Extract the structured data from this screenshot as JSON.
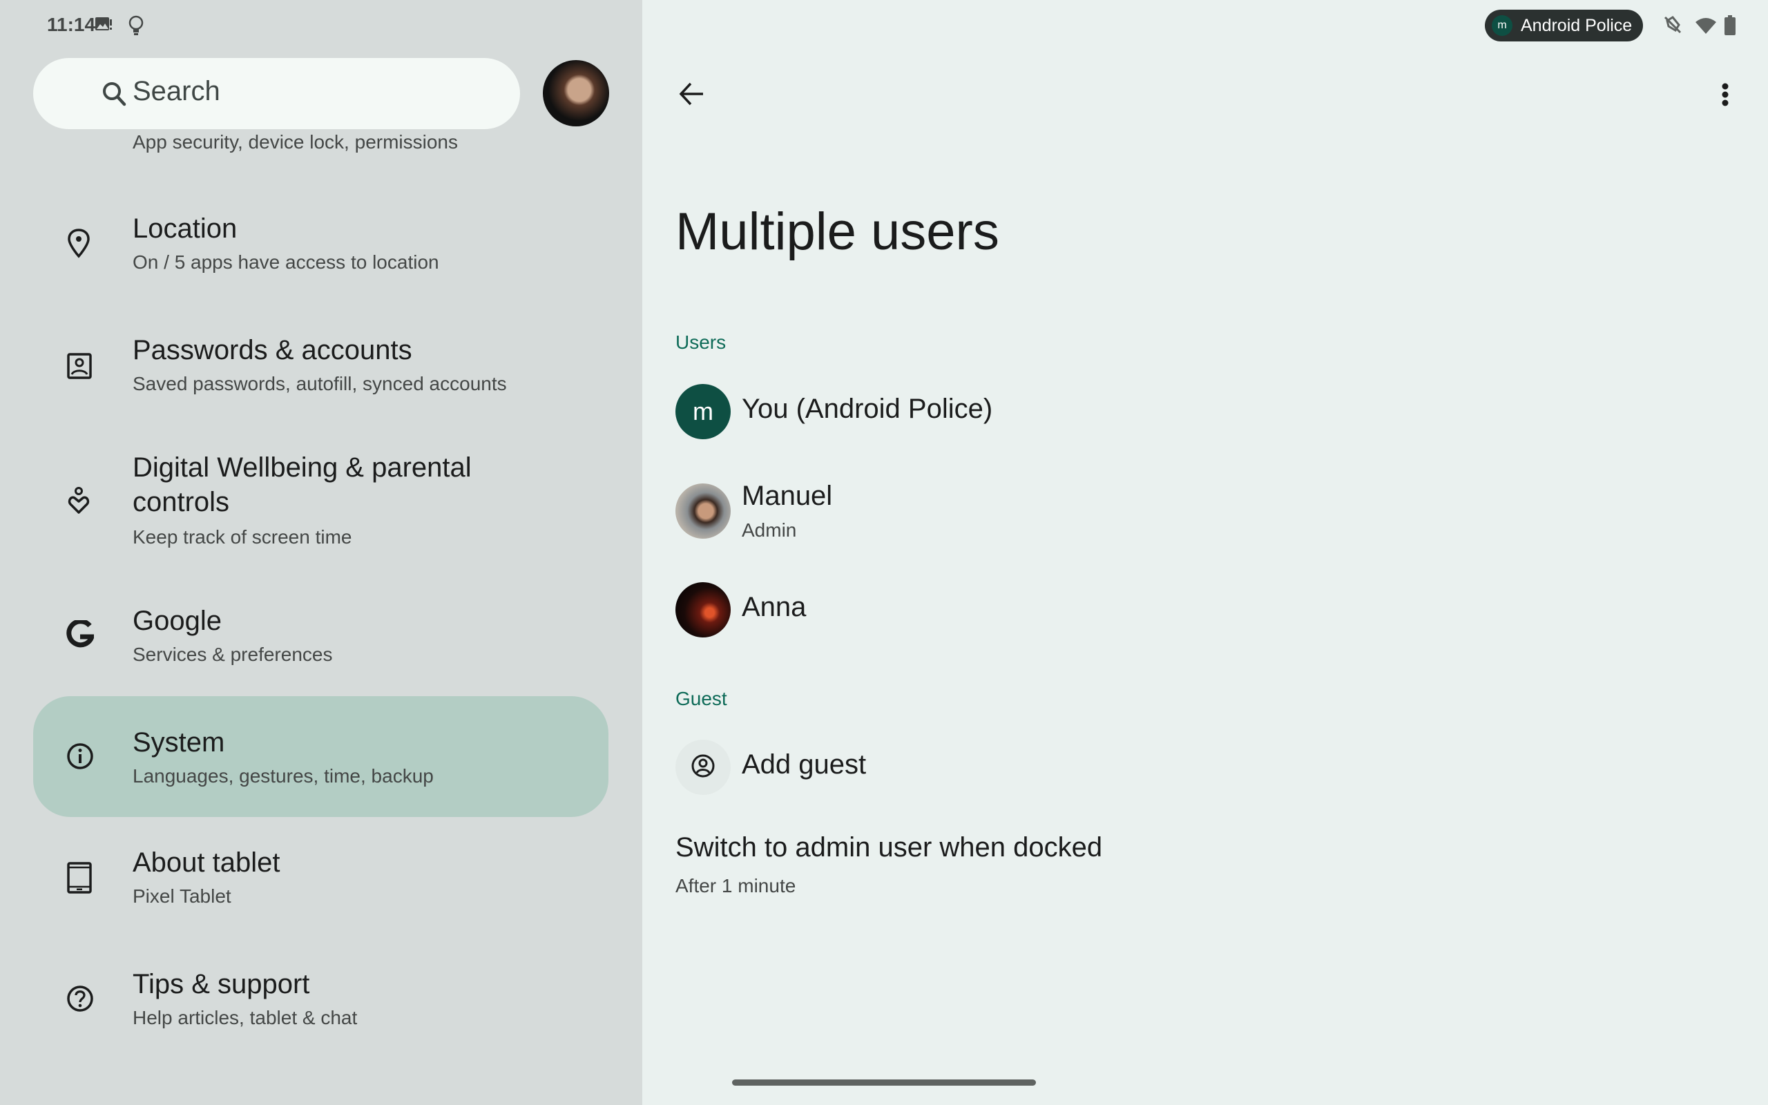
{
  "status_bar": {
    "time": "11:14",
    "left_icons": [
      "image-alert-icon",
      "lightbulb-icon"
    ],
    "user_chip": {
      "initial": "m",
      "name": "Android Police"
    },
    "right_icons": [
      "vibrate-off-icon",
      "wifi-icon",
      "battery-icon"
    ]
  },
  "colors": {
    "left_pane_bg": "#d6dbda",
    "right_pane_bg": "#eaf1ef",
    "selected_item_bg": "#b3cdc4",
    "accent": "#0e6b58",
    "avatar_m_bg": "#0e4f43"
  },
  "sidebar": {
    "search": {
      "placeholder": "Search"
    },
    "partial_item_subtitle": "App security, device lock, permissions",
    "items": [
      {
        "title": "Location",
        "subtitle": "On / 5 apps have access to location",
        "icon": "location-pin-icon"
      },
      {
        "title": "Passwords & accounts",
        "subtitle": "Saved passwords, autofill, synced accounts",
        "icon": "account-box-icon"
      },
      {
        "title": "Digital Wellbeing & parental",
        "title_line2": "controls",
        "subtitle": "Keep track of screen time",
        "icon": "wellbeing-icon"
      },
      {
        "title": "Google",
        "subtitle": "Services & preferences",
        "icon": "google-g-icon"
      },
      {
        "title": "System",
        "subtitle": "Languages, gestures, time, backup",
        "icon": "info-icon",
        "selected": true
      },
      {
        "title": "About tablet",
        "subtitle": "Pixel Tablet",
        "icon": "tablet-icon"
      },
      {
        "title": "Tips & support",
        "subtitle": "Help articles, tablet & chat",
        "icon": "help-icon"
      }
    ]
  },
  "main": {
    "title": "Multiple users",
    "users_section_label": "Users",
    "users": [
      {
        "name": "You (Android Police)",
        "initial": "m",
        "role": null
      },
      {
        "name": "Manuel",
        "role": "Admin"
      },
      {
        "name": "Anna",
        "role": null
      }
    ],
    "guest_section_label": "Guest",
    "add_guest_label": "Add guest",
    "dock_setting": {
      "title": "Switch to admin user when docked",
      "value": "After 1 minute"
    }
  }
}
